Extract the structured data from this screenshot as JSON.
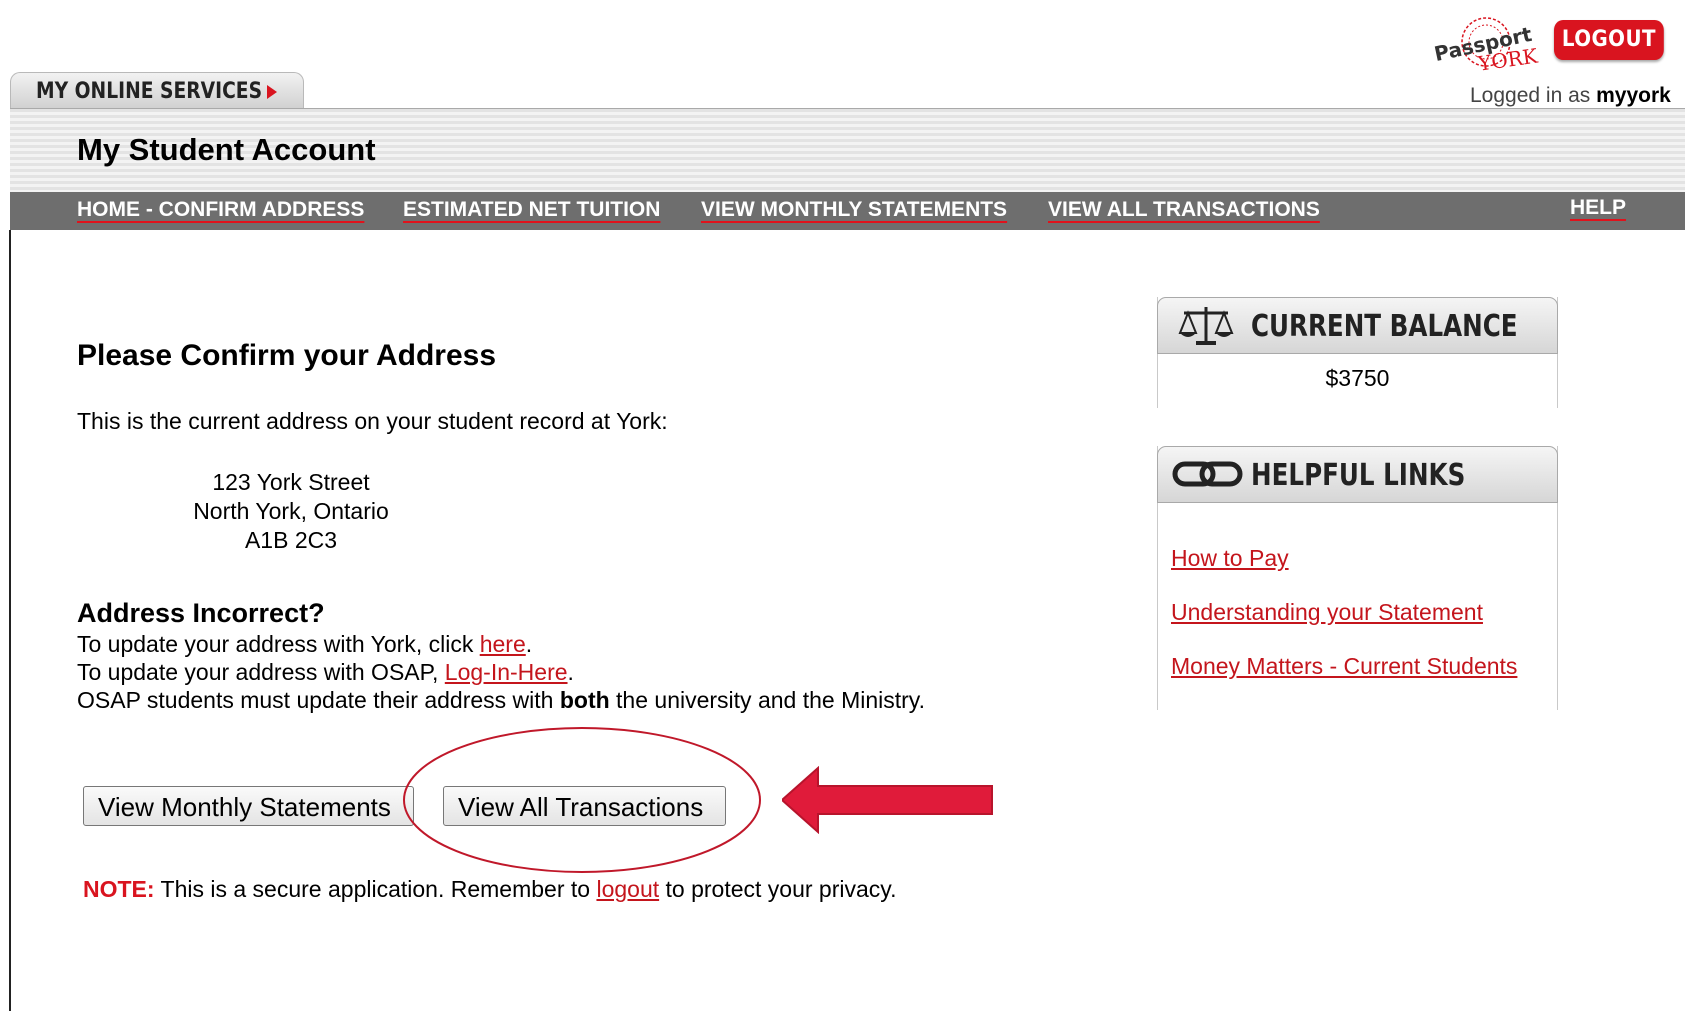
{
  "header": {
    "logo_text_1": "Passport",
    "logo_text_2": "YORK",
    "logout_label": "LOGOUT",
    "logged_in_prefix": "Logged in as ",
    "username": "myyork",
    "services_tab": "MY ONLINE SERVICES",
    "page_title": "My Student Account"
  },
  "nav": {
    "items": [
      {
        "label": "HOME - CONFIRM ADDRESS"
      },
      {
        "label": "ESTIMATED NET TUITION"
      },
      {
        "label": "VIEW MONTHLY STATEMENTS"
      },
      {
        "label": "VIEW ALL TRANSACTIONS"
      }
    ],
    "help": "HELP"
  },
  "main": {
    "heading": "Please Confirm your Address",
    "intro": "This is the current address on your student record at York:",
    "address": [
      "123 York Street",
      "North York, Ontario",
      "A1B 2C3"
    ],
    "incorrect_heading": "Address Incorrect?",
    "line1_prefix": "To update your address with York, click ",
    "line1_link": "here",
    "line1_suffix": ".",
    "line2_prefix": "To update your address with OSAP, ",
    "line2_link": "Log-In-Here",
    "line2_suffix": ".",
    "line3_prefix": "OSAP students must update their address with ",
    "line3_bold": "both",
    "line3_suffix": " the university and the Ministry.",
    "btn_monthly": "View Monthly Statements",
    "btn_all": "View All Transactions",
    "note_label": "NOTE:",
    "note_prefix": " This is a secure application. Remember to ",
    "note_link": "logout",
    "note_suffix": " to protect your privacy."
  },
  "sidebar": {
    "balance_title": "CURRENT BALANCE",
    "balance_value": "$3750",
    "links_title": "HELPFUL LINKS",
    "links": [
      {
        "label": "How to Pay"
      },
      {
        "label": "Understanding your Statement"
      },
      {
        "label": "Money Matters - Current Students"
      }
    ]
  },
  "colors": {
    "accent": "#d9141f",
    "annotation": "#c0182a",
    "nav_bg": "#6e6e6e"
  },
  "icons": [
    "scales-icon",
    "chain-link-icon",
    "arrow-right-icon"
  ]
}
